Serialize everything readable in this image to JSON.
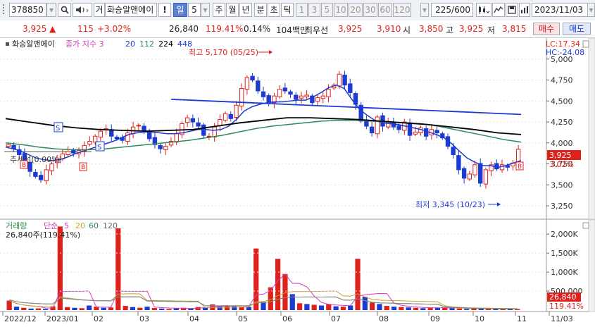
{
  "toolbar": {
    "code": "378850",
    "search_icon": "search-icon",
    "speaker_icon": "speaker-icon",
    "geo_label": "거",
    "name": "화승알앤에이",
    "alert_label": "!",
    "day_label": "일",
    "period_value": "5",
    "week_label": "주",
    "month_label": "월",
    "year_label": "년",
    "minute_label": "분",
    "second_label": "초",
    "tick_label": "틱",
    "intervals": [
      "1",
      "3",
      "5",
      "10",
      "20",
      "30",
      "60",
      "120"
    ],
    "count_value": "225",
    "count_total": "/600",
    "date_value": "2023/11/03"
  },
  "quote": {
    "price": "3,925",
    "change_arrow": "▲",
    "change": "115",
    "change_pct": "+3.02%",
    "volume": "26,840",
    "volume_ratio": "119.41%",
    "turnover": "0.14%",
    "amount": "104백만",
    "best_label": "최우선",
    "best_ask": "3,925",
    "best_bid": "3,910",
    "open_label": "시",
    "open": "3,850",
    "high_label": "고",
    "high": "3,925",
    "low_label": "저",
    "low": "3,815",
    "buy_label": "매수",
    "sell_label": "매도"
  },
  "chart": {
    "stock_label": "화승알앤에이",
    "ma_label": "종가 지수 3",
    "ma_periods": [
      "20",
      "112",
      "224",
      "448"
    ],
    "lc_label": "LC:17.34",
    "hc_label": "HC:-24.08",
    "high_annotation": "최고 5,170 (05/25)",
    "low_annotation": "최저 3,345 (10/23)",
    "trend_label": "추세선(0.00%)",
    "current_price_tag": "3,925",
    "current_pct_tag": "3.02%",
    "signal_s": "S",
    "signal_b": "B",
    "volume_label": "거래량",
    "volume_ma_label": "단순",
    "volume_ma_periods": [
      "5",
      "20",
      "60",
      "120"
    ],
    "volume_current": "26,840주(119.41%)",
    "volume_tag": "26,840",
    "volume_pct_tag": "119.41%",
    "x_labels": [
      "2022/12",
      "2023/01",
      "02",
      "03",
      "04",
      "05",
      "06",
      "07",
      "08",
      "09",
      "10",
      "11",
      "11/03"
    ],
    "colors": {
      "up": "#e0201b",
      "down": "#1c3bd2",
      "ma20": "#1c3bd2",
      "ma112": "#2e8b57",
      "ma224": "#000000",
      "ma448": "#1c3bd2"
    }
  },
  "chart_data": [
    {
      "type": "line",
      "title": "",
      "y_ticks": [
        "5,000",
        "4,750",
        "4,500",
        "4,250",
        "4,000",
        "3,750",
        "3,500",
        "3,250"
      ],
      "ylim": [
        3150,
        5200
      ],
      "price_close": [
        3980,
        3930,
        3860,
        3780,
        3660,
        3600,
        3560,
        3680,
        3750,
        3820,
        3870,
        3900,
        3880,
        3910,
        3970,
        4020,
        4080,
        4140,
        4170,
        4080,
        4050,
        4030,
        4120,
        4190,
        4210,
        4130,
        4050,
        3980,
        3930,
        3960,
        4020,
        4110,
        4230,
        4300,
        4250,
        4200,
        4090,
        4080,
        4190,
        4280,
        4350,
        4290,
        4450,
        4650,
        4780,
        4750,
        4620,
        4550,
        4490,
        4560,
        4640,
        4620,
        4580,
        4520,
        4560,
        4570,
        4480,
        4540,
        4560,
        4640,
        4690,
        4820,
        4690,
        4600,
        4460,
        4260,
        4200,
        4120,
        4310,
        4200,
        4250,
        4190,
        4160,
        4250,
        4090,
        4130,
        4180,
        4080,
        4160,
        4120,
        4060,
        3960,
        3860,
        3680,
        3580,
        3630,
        3740,
        3520,
        3680,
        3740,
        3690,
        3740,
        3710,
        3760,
        3925
      ],
      "ma_20": [
        3950,
        3930,
        3900,
        3860,
        3820,
        3800,
        3790,
        3800,
        3830,
        3870,
        3900,
        3930,
        3960,
        3990,
        4020,
        4060,
        4100,
        4120,
        4130,
        4130,
        4120,
        4110,
        4110,
        4120,
        4140,
        4160,
        4160,
        4150,
        4160,
        4200,
        4280,
        4380,
        4430,
        4460,
        4480,
        4490,
        4490,
        4500,
        4510,
        4510,
        4550,
        4600,
        4660,
        4690,
        4650,
        4520,
        4400,
        4330,
        4270,
        4240,
        4230,
        4220,
        4200,
        4180,
        4160,
        4130,
        4100,
        4060,
        3990,
        3900,
        3820,
        3770,
        3730,
        3730,
        3710,
        3730,
        3760,
        3790
      ],
      "ma_112": [
        4000,
        3980,
        3950,
        3930,
        3920,
        3920,
        3930,
        3950,
        3970,
        3990,
        4010,
        4030,
        4060,
        4090,
        4130,
        4170,
        4200,
        4220,
        4240,
        4260,
        4270,
        4270,
        4260,
        4250,
        4240,
        4230,
        4200,
        4160,
        4120,
        4080,
        4040,
        4010
      ],
      "ma_224": [
        4290,
        4250,
        4210,
        4180,
        4160,
        4150,
        4140,
        4150,
        4160,
        4200,
        4240,
        4270,
        4300,
        4300,
        4290,
        4280,
        4260,
        4240,
        4220,
        4190,
        4160,
        4120,
        4100
      ],
      "ma_448": [
        4520,
        4500,
        4480,
        4460,
        4440,
        4420,
        4400,
        4380,
        4360,
        4340
      ],
      "trend_value": 3895
    },
    {
      "type": "bar",
      "title": "",
      "y_ticks": [
        "2,000K",
        "1,500K",
        "1,000K",
        "500,000"
      ],
      "ylim": [
        0,
        2300000
      ],
      "volume": [
        250000,
        90000,
        60000,
        40000,
        45000,
        30000,
        100000,
        2200000,
        80000,
        60000,
        50000,
        120000,
        90000,
        60000,
        70000,
        2150000,
        110000,
        80000,
        60000,
        90000,
        55000,
        40000,
        30000,
        45000,
        60000,
        50000,
        80000,
        70000,
        150000,
        120000,
        110000,
        100000,
        90000,
        80000,
        1620000,
        210000,
        600000,
        1350000,
        950000,
        420000,
        180000,
        160000,
        140000,
        120000,
        160000,
        100000,
        90000,
        120000,
        1350000,
        350000,
        200000,
        160000,
        110000,
        90000,
        80000,
        70000,
        60000,
        50000,
        55000,
        60000,
        70000,
        50000,
        40000,
        30000,
        50000,
        40000,
        30000,
        35000,
        30000,
        40000,
        27000
      ]
    }
  ]
}
